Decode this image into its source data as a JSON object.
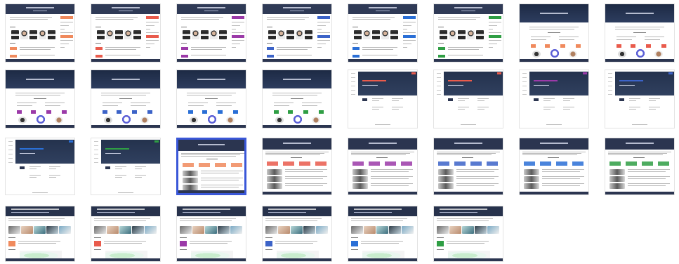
{
  "gallery": {
    "title": "",
    "selected_index": 18
  },
  "accents": [
    "#f08a5d",
    "#e95b4c",
    "#9b3aa8",
    "#3c63c8",
    "#2a6fd6",
    "#2f9e44"
  ],
  "row1": [
    {
      "accent": "#f08a5d"
    },
    {
      "accent": "#e95b4c"
    },
    {
      "accent": "#9b3aa8"
    },
    {
      "accent": "#3c63c8"
    },
    {
      "accent": "#2a6fd6"
    },
    {
      "accent": "#2f9e44"
    },
    {
      "accent": "#f08a5d"
    },
    {
      "accent": "#e95b4c"
    }
  ],
  "row2": [
    {
      "accent": "#9b3aa8"
    },
    {
      "accent": "#3c63c8"
    },
    {
      "accent": "#2a6fd6"
    },
    {
      "accent": "#2f9e44"
    },
    {
      "accent": "#e95b4c"
    },
    {
      "accent": "#e95b4c"
    },
    {
      "accent": "#9b3aa8"
    },
    {
      "accent": "#3c63c8"
    }
  ],
  "row3": [
    {
      "accent": "#2a6fd6"
    },
    {
      "accent": "#2f9e44"
    },
    {
      "accent": "#f08a5d"
    },
    {
      "accent": "#e95b4c"
    },
    {
      "accent": "#9b3aa8"
    },
    {
      "accent": "#3c63c8"
    },
    {
      "accent": "#2a6fd6"
    },
    {
      "accent": "#2f9e44"
    }
  ],
  "row4": [
    {
      "accent": "#f08a5d"
    },
    {
      "accent": "#e95b4c"
    },
    {
      "accent": "#9b3aa8"
    },
    {
      "accent": "#3c63c8"
    },
    {
      "accent": "#2a6fd6"
    },
    {
      "accent": "#2f9e44"
    }
  ]
}
